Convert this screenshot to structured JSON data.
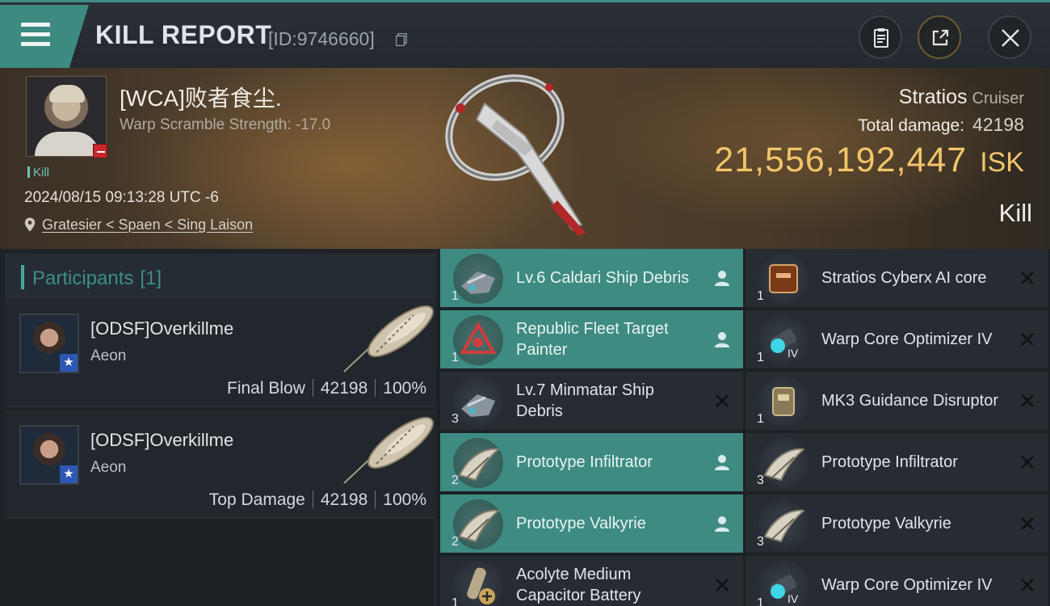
{
  "header": {
    "title": "KILL REPORT",
    "kill_id": "[ID:9746660]"
  },
  "victim": {
    "name": "[WCA]败者食尘.",
    "warp_scramble": "Warp Scramble Strength: -17.0",
    "tag": "Kill",
    "datetime": "2024/08/15 09:13:28 UTC -6",
    "location": "Gratesier < Spaen < Sing Laison",
    "ship_name": "Stratios",
    "ship_class": "Cruiser",
    "total_damage_label": "Total damage:",
    "total_damage": "42198",
    "isk_value": "21,556,192,447",
    "isk_unit": "ISK",
    "result": "Kill"
  },
  "participants": {
    "label": "Participants",
    "count": "[1]",
    "list": [
      {
        "name": "[ODSF]Overkillme",
        "ship": "Aeon",
        "role": "Final Blow",
        "damage": "42198",
        "percent": "100%"
      },
      {
        "name": "[ODSF]Overkillme",
        "ship": "Aeon",
        "role": "Top Damage",
        "damage": "42198",
        "percent": "100%"
      }
    ]
  },
  "items": {
    "left": [
      {
        "name": "Lv.6 Caldari Ship Debris",
        "qty": "1",
        "status": "dropped",
        "icon": "debris-icon"
      },
      {
        "name": "Republic Fleet Target Painter",
        "qty": "1",
        "status": "dropped",
        "icon": "target-painter-icon"
      },
      {
        "name": "Lv.7 Minmatar Ship Debris",
        "qty": "3",
        "status": "destroyed",
        "icon": "debris-icon"
      },
      {
        "name": "Prototype  Infiltrator",
        "qty": "2",
        "status": "dropped",
        "icon": "drone-icon"
      },
      {
        "name": "Prototype  Valkyrie",
        "qty": "2",
        "status": "dropped",
        "icon": "drone-icon"
      },
      {
        "name": "Acolyte Medium Capacitor Battery",
        "qty": "1",
        "status": "destroyed",
        "icon": "battery-icon"
      }
    ],
    "right": [
      {
        "name": "Stratios Cyberx AI core",
        "qty": "1",
        "status": "destroyed",
        "icon": "ai-core-icon"
      },
      {
        "name": "Warp Core Optimizer IV",
        "qty": "1",
        "status": "destroyed",
        "icon": "warp-core-icon"
      },
      {
        "name": "MK3 Guidance Disruptor",
        "qty": "1",
        "status": "destroyed",
        "icon": "guidance-disruptor-icon"
      },
      {
        "name": "Prototype  Infiltrator",
        "qty": "3",
        "status": "destroyed",
        "icon": "drone-icon"
      },
      {
        "name": "Prototype  Valkyrie",
        "qty": "3",
        "status": "destroyed",
        "icon": "drone-icon"
      },
      {
        "name": "Warp Core Optimizer IV",
        "qty": "1",
        "status": "destroyed",
        "icon": "warp-core-icon"
      }
    ]
  },
  "colors": {
    "accent": "#3d8a80",
    "isk": "#f1c56a",
    "victim_badge": "#c8282c"
  }
}
